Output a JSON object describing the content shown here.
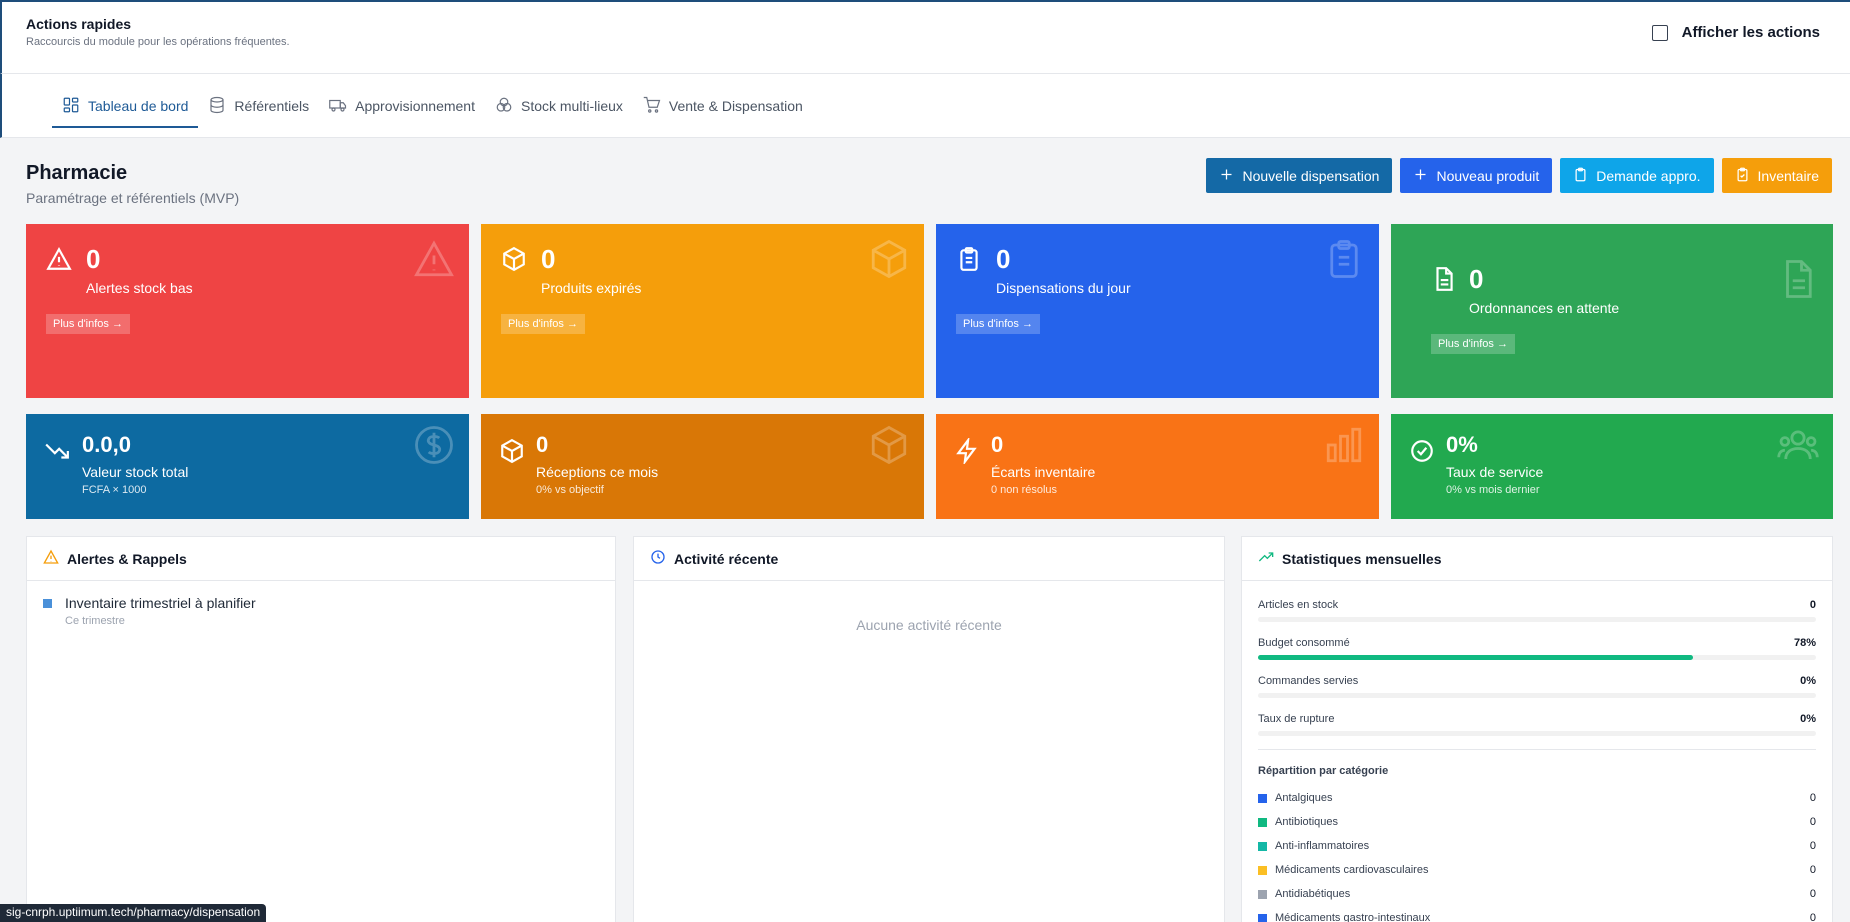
{
  "quick_actions": {
    "title": "Actions rapides",
    "subtitle": "Raccourcis du module pour les opérations fréquentes.",
    "toggle_label": "Afficher les actions"
  },
  "tabs": [
    {
      "label": "Tableau de bord",
      "icon": "dashboard-icon",
      "active": true
    },
    {
      "label": "Référentiels",
      "icon": "database-icon",
      "active": false
    },
    {
      "label": "Approvisionnement",
      "icon": "truck-icon",
      "active": false
    },
    {
      "label": "Stock multi-lieux",
      "icon": "boxes-icon",
      "active": false
    },
    {
      "label": "Vente & Dispensation",
      "icon": "cart-icon",
      "active": false
    }
  ],
  "page": {
    "title": "Pharmacie",
    "subtitle": "Paramétrage et référentiels (MVP)"
  },
  "actions": {
    "new_dispensation": "Nouvelle dispensation",
    "new_product": "Nouveau produit",
    "supply_request": "Demande appro.",
    "inventory": "Inventaire"
  },
  "cards_top": [
    {
      "value": "0",
      "label": "Alertes stock bas",
      "more": "Plus d'infos →",
      "color": "#ef4444",
      "icon": "alert-triangle-icon"
    },
    {
      "value": "0",
      "label": "Produits expirés",
      "more": "Plus d'infos →",
      "color": "#f59e0b",
      "icon": "box-icon"
    },
    {
      "value": "0",
      "label": "Dispensations du jour",
      "more": "Plus d'infos →",
      "color": "#2563eb",
      "icon": "clipboard-icon"
    },
    {
      "value": "0",
      "label": "Ordonnances en attente",
      "more": "Plus d'infos →",
      "color": "#2ea556",
      "icon": "file-icon"
    }
  ],
  "cards_bottom": [
    {
      "value": "0.0,0",
      "label": "Valeur stock total",
      "sub": "FCFA × 1000",
      "color": "#0d6aa1",
      "icon": "trend-down-icon",
      "bg_icon": "dollar-icon"
    },
    {
      "value": "0",
      "label": "Réceptions ce mois",
      "sub": "0% vs objectif",
      "color": "#d97706",
      "icon": "box-icon",
      "bg_icon": "box-icon"
    },
    {
      "value": "0",
      "label": "Écarts inventaire",
      "sub": "0 non résolus",
      "color": "#f97316",
      "icon": "zap-icon",
      "bg_icon": "bar-chart-icon"
    },
    {
      "value": "0%",
      "label": "Taux de service",
      "sub": "0% vs mois dernier",
      "color": "#22a94f",
      "icon": "check-circle-icon",
      "bg_icon": "users-icon"
    }
  ],
  "alerts_panel": {
    "title": "Alertes & Rappels",
    "item_text": "Inventaire trimestriel à planifier",
    "item_sub": "Ce trimestre"
  },
  "activity_panel": {
    "title": "Activité récente",
    "empty": "Aucune activité récente"
  },
  "stats_panel": {
    "title": "Statistiques mensuelles",
    "stats": [
      {
        "label": "Articles en stock",
        "value": "0",
        "progress": 0
      },
      {
        "label": "Budget consommé",
        "value": "78%",
        "progress": 78
      },
      {
        "label": "Commandes servies",
        "value": "0%",
        "progress": 0
      },
      {
        "label": "Taux de rupture",
        "value": "0%",
        "progress": 0
      }
    ],
    "categories_title": "Répartition par catégorie",
    "categories": [
      {
        "name": "Antalgiques",
        "value": "0",
        "color": "#2563eb"
      },
      {
        "name": "Antibiotiques",
        "value": "0",
        "color": "#10b981"
      },
      {
        "name": "Anti-inflammatoires",
        "value": "0",
        "color": "#14b8a6"
      },
      {
        "name": "Médicaments cardiovasculaires",
        "value": "0",
        "color": "#fbbf24"
      },
      {
        "name": "Antidiabétiques",
        "value": "0",
        "color": "#9ca3af"
      },
      {
        "name": "Médicaments gastro-intestinaux",
        "value": "0",
        "color": "#2563eb"
      }
    ]
  },
  "status_url": "sig-cnrph.uptiimum.tech/pharmacy/dispensation"
}
